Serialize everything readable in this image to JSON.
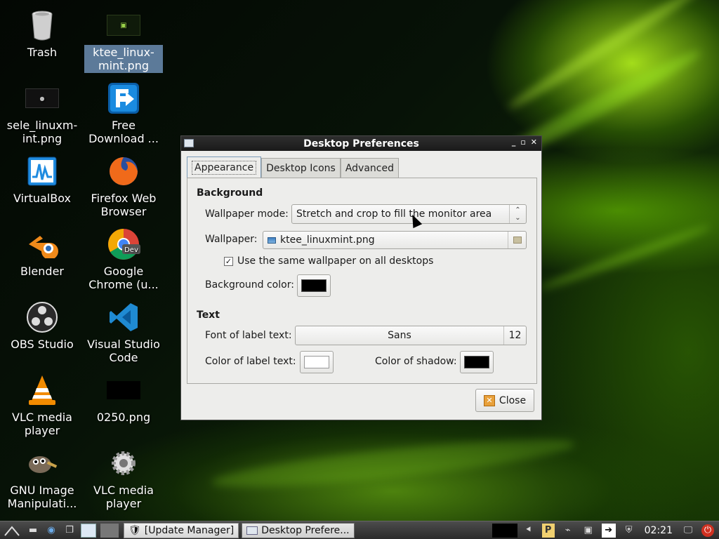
{
  "desktop": {
    "icons": [
      {
        "label": "Trash",
        "icon": "trash-icon"
      },
      {
        "label": "ktee_linux-mint.png",
        "icon": "image-file-icon",
        "selected": true
      },
      {
        "label": "sele_linuxm-int.png",
        "icon": "image-file-icon"
      },
      {
        "label": "Free Download ...",
        "icon": "download-manager-icon"
      },
      {
        "label": "VirtualBox",
        "icon": "virtualbox-icon"
      },
      {
        "label": "Firefox Web Browser",
        "icon": "firefox-icon"
      },
      {
        "label": "Blender",
        "icon": "blender-icon"
      },
      {
        "label": "Google Chrome (u...",
        "icon": "chrome-dev-icon"
      },
      {
        "label": "OBS Studio",
        "icon": "obs-icon"
      },
      {
        "label": "Visual Studio Code",
        "icon": "vscode-icon"
      },
      {
        "label": "VLC media player",
        "icon": "vlc-icon"
      },
      {
        "label": "0250.png",
        "icon": "image-file-icon"
      },
      {
        "label": "GNU Image Manipulati...",
        "icon": "gimp-icon"
      },
      {
        "label": "VLC media player",
        "icon": "gear-icon"
      }
    ]
  },
  "dialog": {
    "title": "Desktop Preferences",
    "tabs": [
      "Appearance",
      "Desktop Icons",
      "Advanced"
    ],
    "active_tab": "Appearance",
    "background": {
      "section_title": "Background",
      "wallpaper_mode_label": "Wallpaper mode:",
      "wallpaper_mode_value": "Stretch and crop to fill the monitor area",
      "wallpaper_label": "Wallpaper:",
      "wallpaper_value": "ktee_linuxmint.png",
      "same_wallpaper_label": "Use the same wallpaper on all desktops",
      "same_wallpaper_checked": true,
      "bg_color_label": "Background color:",
      "bg_color": "#000000"
    },
    "text": {
      "section_title": "Text",
      "font_label": "Font of label text:",
      "font_name": "Sans",
      "font_size": "12",
      "label_color_label": "Color of label text:",
      "label_color": "#ffffff",
      "shadow_color_label": "Color of shadow:",
      "shadow_color": "#000000"
    },
    "close_label": "Close"
  },
  "taskbar": {
    "tasks": [
      {
        "label": "[Update Manager]",
        "icon": "shield-icon"
      },
      {
        "label": "Desktop Prefere...",
        "icon": "window-icon",
        "active": true
      }
    ],
    "clock": "02:21"
  }
}
